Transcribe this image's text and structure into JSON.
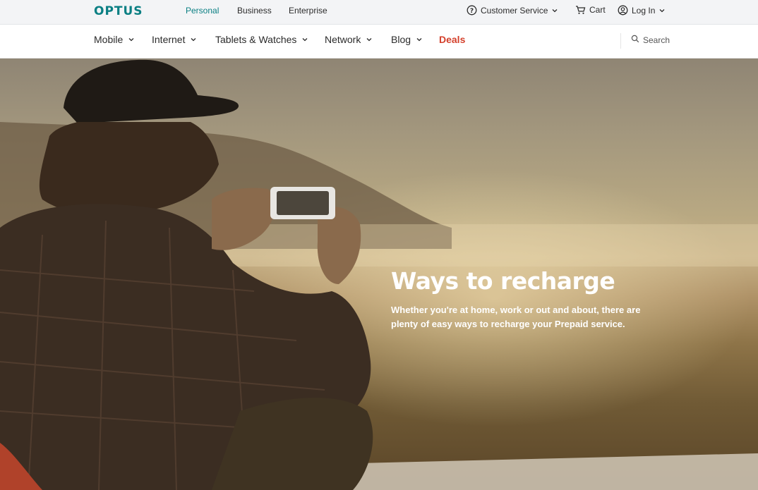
{
  "brand": {
    "logo_text": "OPTUS",
    "accent_color": "#0a7f83",
    "deals_color": "#d4412c"
  },
  "segments": [
    {
      "label": "Personal",
      "active": true
    },
    {
      "label": "Business",
      "active": false
    },
    {
      "label": "Enterprise",
      "active": false
    }
  ],
  "utility": {
    "customer_service": "Customer Service",
    "cart": "Cart",
    "login": "Log In"
  },
  "nav": {
    "items": [
      {
        "label": "Mobile",
        "has_dropdown": true
      },
      {
        "label": "Internet",
        "has_dropdown": true
      },
      {
        "label": "Tablets & Watches",
        "has_dropdown": true
      },
      {
        "label": "Network",
        "has_dropdown": true
      },
      {
        "label": "Blog",
        "has_dropdown": true
      },
      {
        "label": "Deals",
        "has_dropdown": false
      }
    ],
    "search_label": "Search"
  },
  "hero": {
    "title": "Ways to recharge",
    "body": "Whether you're at home, work or out and about, there are plenty of easy ways to recharge your Prepaid service."
  }
}
